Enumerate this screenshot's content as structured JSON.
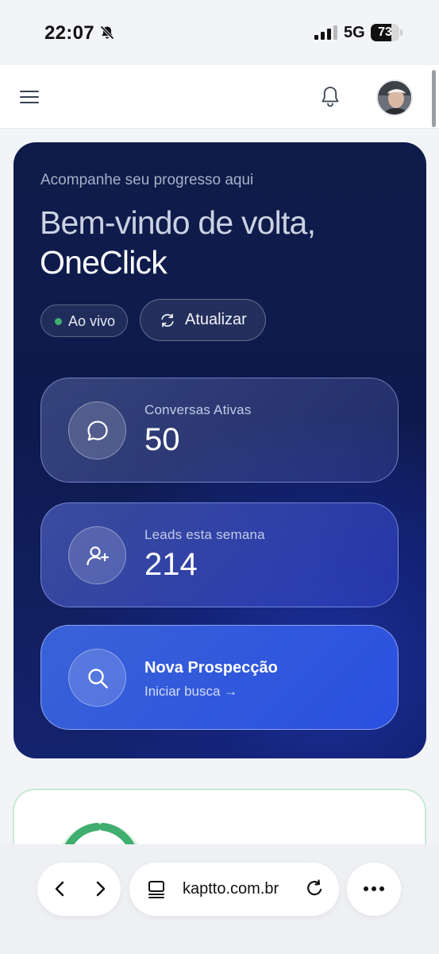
{
  "status_bar": {
    "time": "22:07",
    "network": "5G",
    "battery_level": "73",
    "battery_fraction": 0.73,
    "silent_icon": "bell-slash-icon",
    "signal_icon": "signal-bars-icon"
  },
  "header": {
    "menu_icon": "hamburger-menu-icon",
    "notification_icon": "bell-icon",
    "avatar": "user-avatar"
  },
  "hero": {
    "subtitle": "Acompanhe seu progresso aqui",
    "title": "Bem-vindo de volta,",
    "name": "OneClick",
    "live_label": "Ao vivo",
    "live_color": "#3fae6e",
    "refresh_label": "Atualizar"
  },
  "stats": [
    {
      "icon": "chat-bubble-icon",
      "label": "Conversas Ativas",
      "value": "50"
    },
    {
      "icon": "user-plus-icon",
      "label": "Leads esta semana",
      "value": "214"
    }
  ],
  "prospect": {
    "icon": "search-icon",
    "title": "Nova Prospecção",
    "link": "Iniciar busca →"
  },
  "colors": {
    "hero_bg": "#0f1c4a",
    "accent_blue": "#3057dd",
    "progress_green": "#3fae6e"
  },
  "browser": {
    "url": "kaptto.com.br",
    "back_icon": "chevron-left-icon",
    "forward_icon": "chevron-right-icon",
    "tabs_icon": "tabs-icon",
    "reload_icon": "reload-icon",
    "more_icon": "more-dots-icon"
  }
}
